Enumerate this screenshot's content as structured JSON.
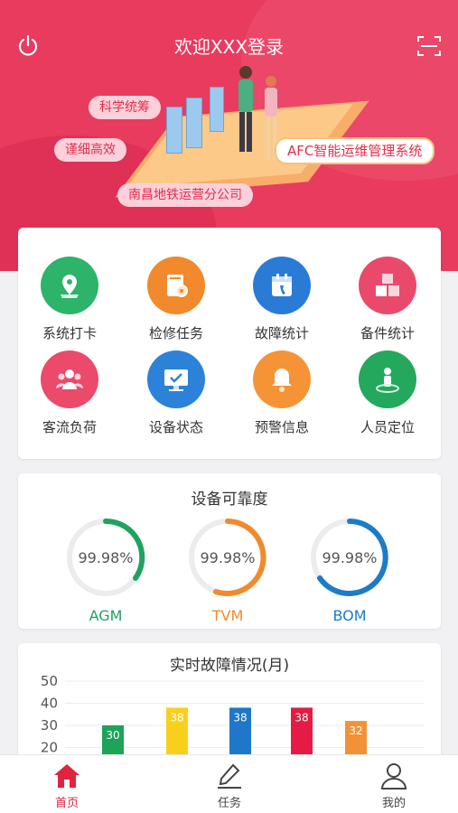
{
  "header": {
    "title": "欢迎XXX登录",
    "power_icon": "power-icon",
    "scan_icon": "scan-icon"
  },
  "banner": {
    "tag1": "科学统筹",
    "tag2": "谨细高效",
    "tag3": "南昌地铁运营分公司",
    "system_name": "AFC智能运维管理系统"
  },
  "menu": {
    "items": [
      {
        "label": "系统打卡",
        "icon": "map-pin-icon",
        "color": "#2db36a"
      },
      {
        "label": "检修任务",
        "icon": "book-gear-icon",
        "color": "#f08a2c"
      },
      {
        "label": "故障统计",
        "icon": "calendar-wrench-icon",
        "color": "#2a7bd6"
      },
      {
        "label": "备件统计",
        "icon": "cubes-icon",
        "color": "#e94a6c"
      },
      {
        "label": "客流负荷",
        "icon": "people-icon",
        "color": "#ec4a6a"
      },
      {
        "label": "设备状态",
        "icon": "monitor-check-icon",
        "color": "#2c82d8"
      },
      {
        "label": "预警信息",
        "icon": "bell-icon",
        "color": "#f49436"
      },
      {
        "label": "人员定位",
        "icon": "person-location-icon",
        "color": "#23a85d"
      }
    ]
  },
  "reliability": {
    "title": "设备可靠度",
    "gauges": [
      {
        "name": "AGM",
        "value": "99.98%",
        "color": "#1fa35e"
      },
      {
        "name": "TVM",
        "value": "99.98%",
        "color": "#ef8b2d"
      },
      {
        "name": "BOM",
        "value": "99.98%",
        "color": "#1c7cc8"
      }
    ]
  },
  "fault": {
    "title": "实时故障情况(月)"
  },
  "chart_data": {
    "type": "bar",
    "title": "实时故障情况(月)",
    "yticks": [
      "50",
      "40",
      "30",
      "20"
    ],
    "ylim": [
      15,
      50
    ],
    "values": [
      30,
      38,
      38,
      38,
      32
    ],
    "labels": [
      "30",
      "38",
      "38",
      "38",
      "32"
    ],
    "colors": [
      "#1ea35b",
      "#f8d01c",
      "#1e77c9",
      "#e51b45",
      "#f29237"
    ]
  },
  "tabs": [
    {
      "label": "首页",
      "icon": "home-icon",
      "active": true
    },
    {
      "label": "任务",
      "icon": "edit-icon",
      "active": false
    },
    {
      "label": "我的",
      "icon": "user-icon",
      "active": false
    }
  ],
  "theme": {
    "accent": "#e83b5e"
  }
}
